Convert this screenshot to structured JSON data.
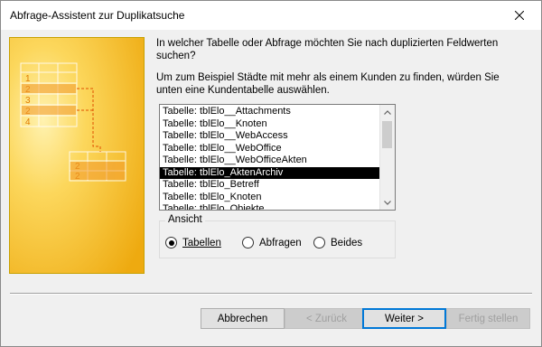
{
  "window": {
    "title": "Abfrage-Assistent zur Duplikatsuche"
  },
  "intro": {
    "question": "In welcher Tabelle oder Abfrage möchten Sie nach duplizierten Feldwerten suchen?",
    "example": "Um zum Beispiel Städte mit mehr als einem Kunden zu finden, würden Sie unten eine Kundentabelle auswählen."
  },
  "list": {
    "items": [
      "Tabelle: tblElo__Attachments",
      "Tabelle: tblElo__Knoten",
      "Tabelle: tblElo__WebAccess",
      "Tabelle: tblElo__WebOffice",
      "Tabelle: tblElo__WebOfficeAkten",
      "Tabelle: tblElo_AktenArchiv",
      "Tabelle: tblElo_Betreff",
      "Tabelle: tblElo_Knoten",
      "Tabelle: tblElo_Objekte"
    ],
    "selected_index": 5
  },
  "view": {
    "title": "Ansicht",
    "options": [
      "Tabellen",
      "Abfragen",
      "Beides"
    ],
    "selected": "Tabellen"
  },
  "buttons": {
    "cancel": "Abbrechen",
    "back": "< Zurück",
    "next": "Weiter >",
    "finish": "Fertig stellen"
  },
  "illustration": {
    "left_rows": [
      "1",
      "2",
      "3",
      "2",
      "4"
    ],
    "right_rows": [
      "2",
      "2"
    ]
  },
  "colors": {
    "accent": "#0078d7",
    "illustration_bg": "#f7c234",
    "selected_bg": "#000000"
  },
  "icons": {
    "close": "close-icon"
  }
}
